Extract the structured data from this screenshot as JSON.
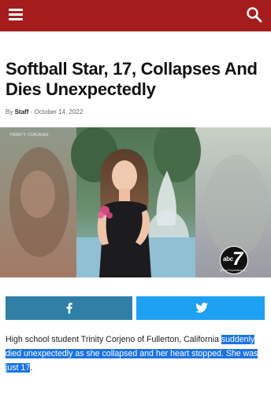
{
  "header": {
    "bg_color": "#a51c1c",
    "menu_icon": "hamburger-menu-icon",
    "search_icon": "magnifier-search-icon"
  },
  "article": {
    "title": "Softball Star, 17, Collapses And Dies Unexpectedly",
    "byline_prefix": "By",
    "author": "Staff",
    "separator": "-",
    "date": "October 14, 2022",
    "image_credit": "TRINITY CORJENO",
    "image_logo_handle": "@abc7eyewitness",
    "body_plain": "High school student Trinity Corjeno of Fullerton, California",
    "body_highlighted": "suddenly died unexpectedly as she collapsed and her heart stopped. She was just 17",
    "body_end": "."
  },
  "share": {
    "facebook_icon": "facebook-f-icon",
    "facebook_color": "#2f7fa6",
    "twitter_icon": "twitter-bird-icon",
    "twitter_color": "#1da1f2"
  }
}
